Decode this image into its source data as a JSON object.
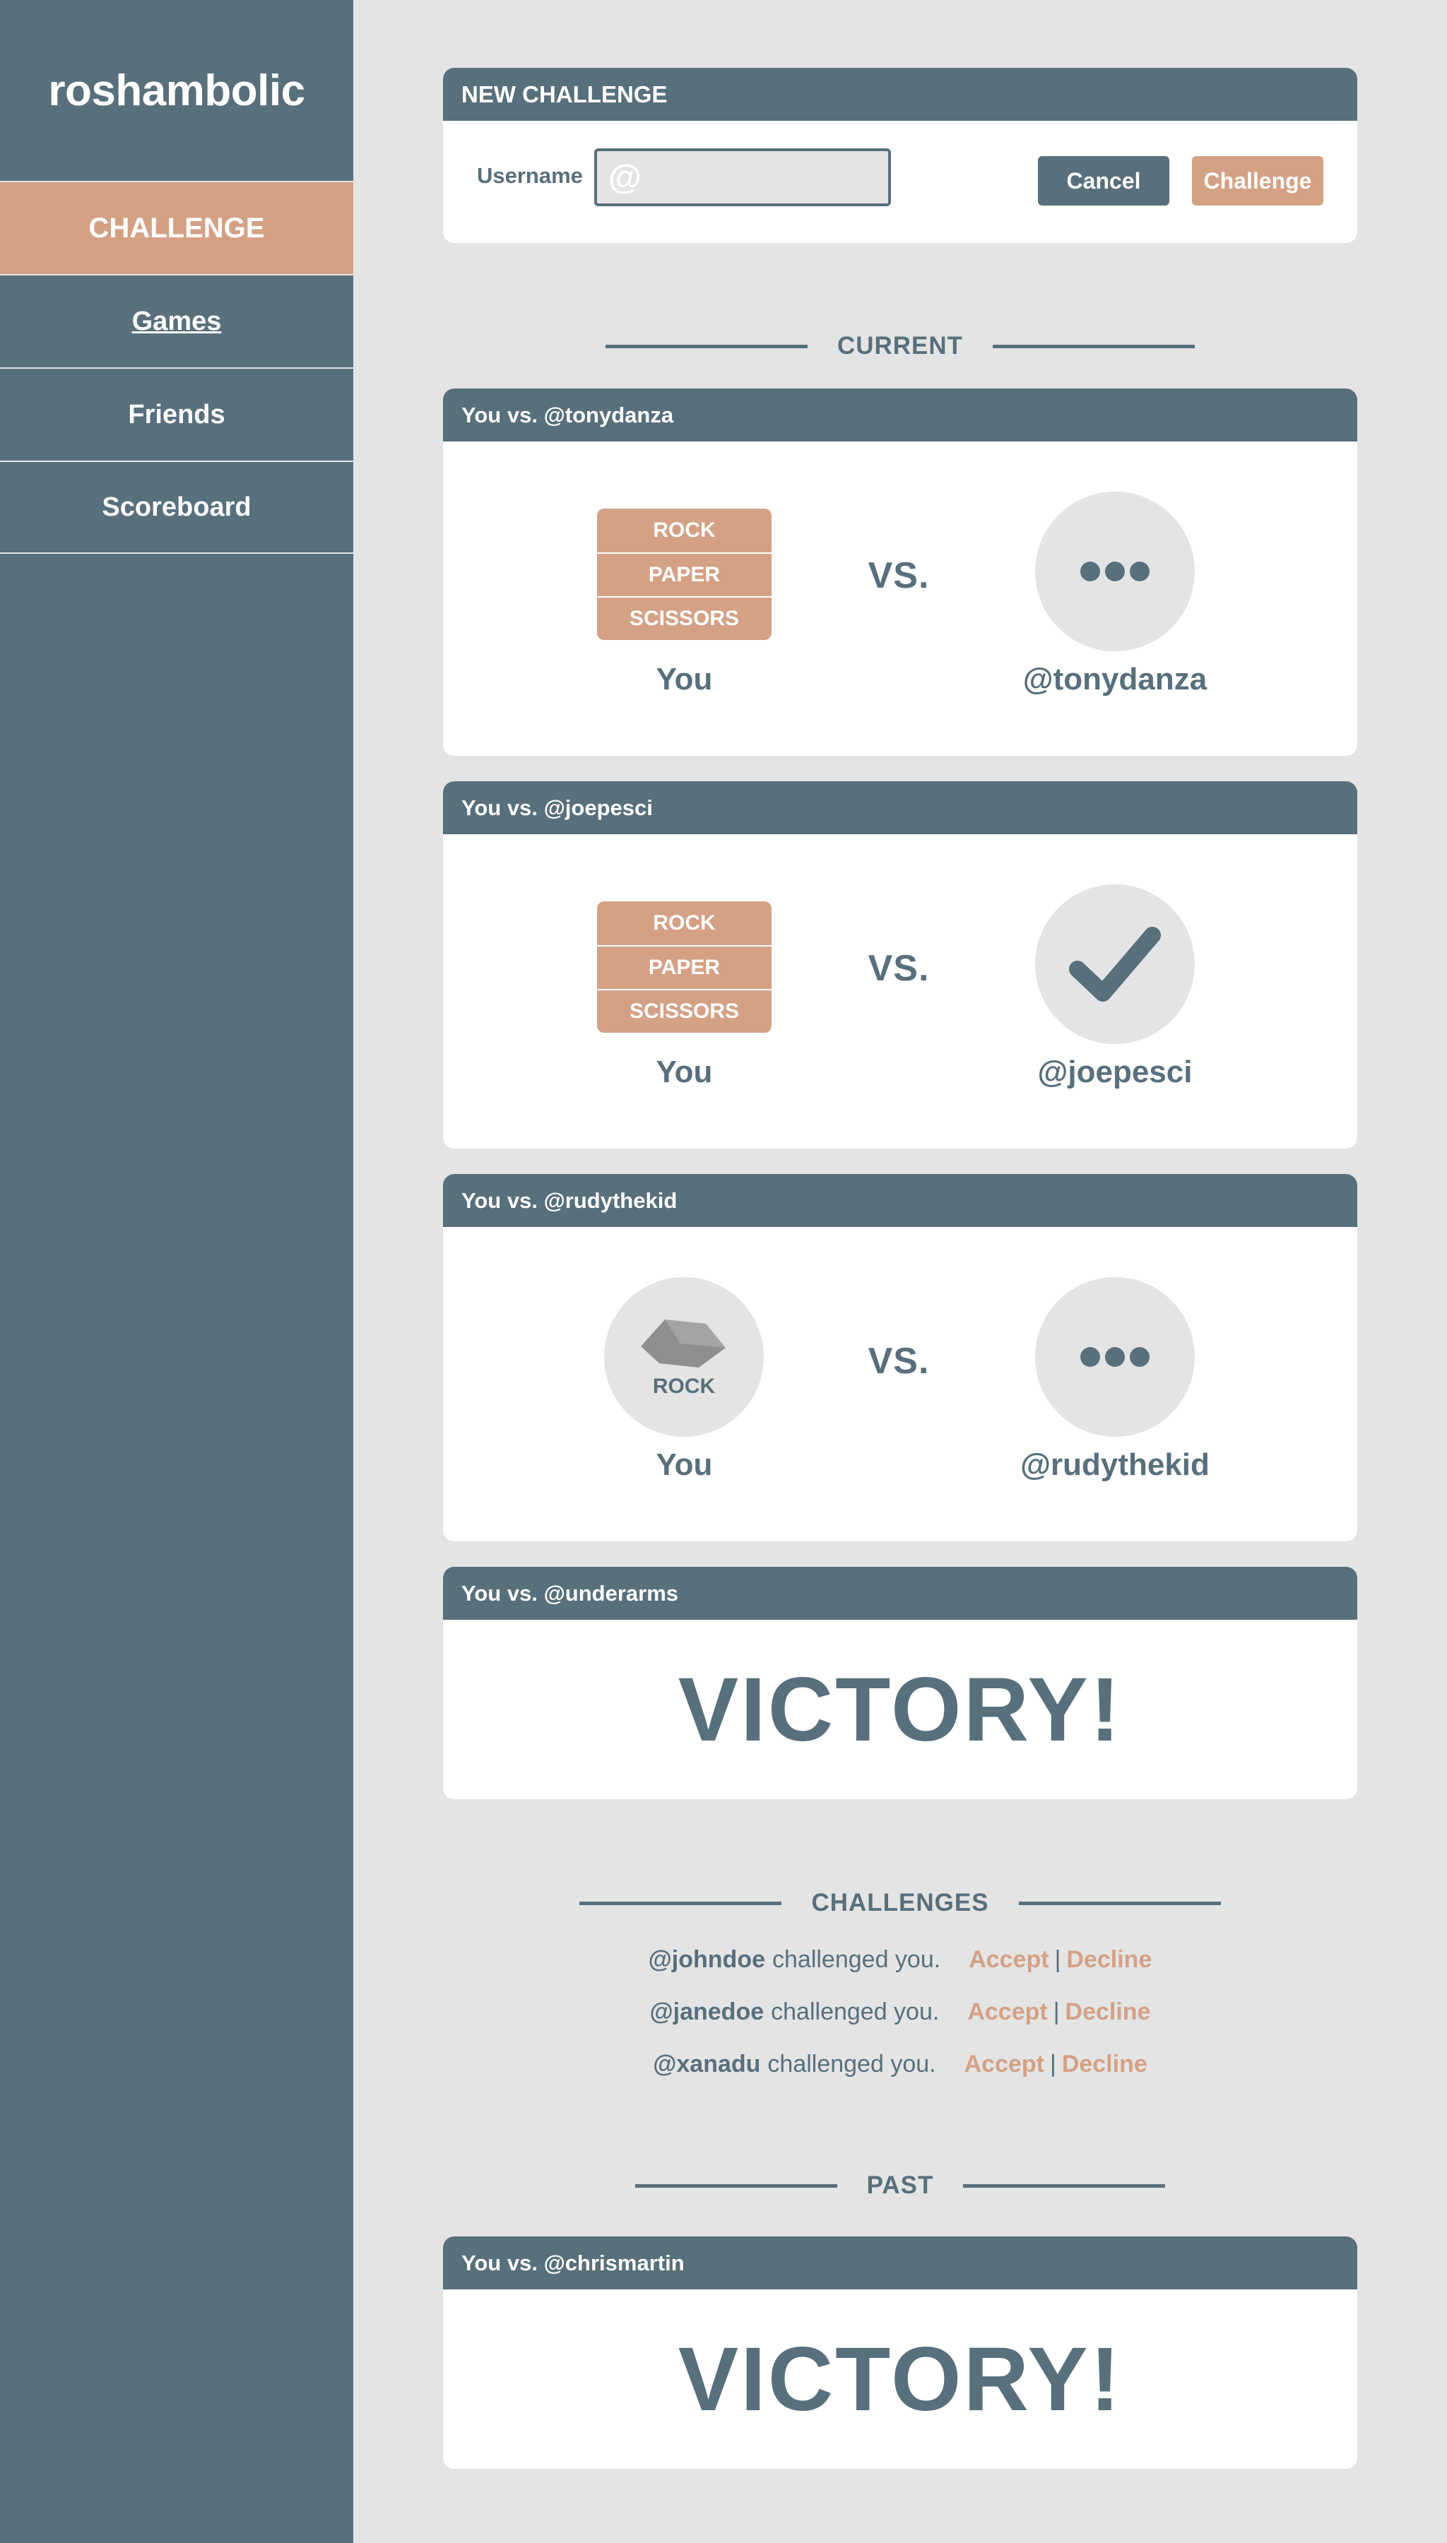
{
  "app": {
    "title": "roshambolic"
  },
  "sidebar": {
    "items": [
      {
        "label": "CHALLENGE"
      },
      {
        "label": "Games"
      },
      {
        "label": "Friends"
      },
      {
        "label": "Scoreboard"
      }
    ]
  },
  "new_challenge": {
    "title": "NEW CHALLENGE",
    "username_label": "Username",
    "username_value": "",
    "username_placeholder": "@",
    "cancel_label": "Cancel",
    "challenge_label": "Challenge"
  },
  "sections": {
    "current": "CURRENT",
    "challenges": "CHALLENGES",
    "past": "PAST"
  },
  "current_games": [
    {
      "header": "You vs. @tonydanza",
      "choices": [
        "ROCK",
        "PAPER",
        "SCISSORS"
      ],
      "vs": "VS.",
      "you": "You",
      "opponent": "@tonydanza",
      "opponent_status": "waiting"
    },
    {
      "header": "You vs. @joepesci",
      "choices": [
        "ROCK",
        "PAPER",
        "SCISSORS"
      ],
      "vs": "VS.",
      "you": "You",
      "opponent": "@joepesci",
      "opponent_status": "ready"
    },
    {
      "header": "You vs. @rudythekid",
      "your_pick": "ROCK",
      "vs": "VS.",
      "you": "You",
      "opponent": "@rudythekid",
      "opponent_status": "waiting"
    },
    {
      "header": "You vs. @underarms",
      "result": "VICTORY!"
    }
  ],
  "challenges": [
    {
      "user": "@johndoe",
      "text": "challenged you.",
      "accept": "Accept",
      "decline": "Decline"
    },
    {
      "user": "@janedoe",
      "text": "challenged you.",
      "accept": "Accept",
      "decline": "Decline"
    },
    {
      "user": "@xanadu",
      "text": "challenged you.",
      "accept": "Accept",
      "decline": "Decline"
    }
  ],
  "past_games": [
    {
      "header": "You vs. @chrismartin",
      "result": "VICTORY!"
    }
  ],
  "colors": {
    "primary": "#586f7c",
    "accent": "#d4a185",
    "background": "#e4e4e4",
    "card": "#ffffff"
  }
}
